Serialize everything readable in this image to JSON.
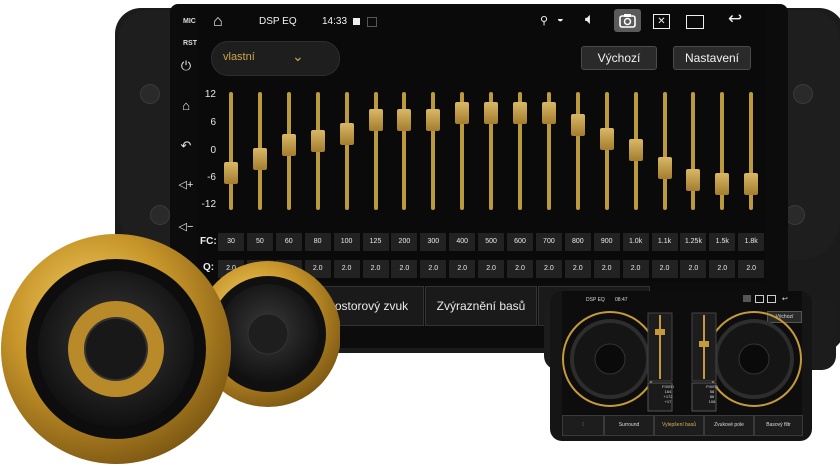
{
  "status_bar": {
    "title": "DSP EQ",
    "time": "14:33",
    "icons": [
      "home-icon",
      "gallery-icon",
      "location-icon",
      "wifi-icon",
      "volume-icon",
      "camera-icon",
      "close-window-icon",
      "window-icon",
      "back-icon"
    ]
  },
  "side_panel": {
    "mic_label": "MIC",
    "rst_label": "RST",
    "icons": [
      "power-icon",
      "home-icon",
      "back-icon",
      "volume-up-icon",
      "volume-down-icon"
    ]
  },
  "eq": {
    "preset_value": "vlastní",
    "default_button": "Výchozí",
    "settings_button": "Nastavení",
    "y_axis": [
      "12",
      "6",
      "0",
      "-6",
      "-12"
    ],
    "fc_label": "FC:",
    "q_label": "Q:",
    "bands": [
      {
        "fc": "30",
        "q": "2.0",
        "gain": -5.0
      },
      {
        "fc": "50",
        "q": "2.0",
        "gain": -2.0
      },
      {
        "fc": "60",
        "q": "2.0",
        "gain": 1.0
      },
      {
        "fc": "80",
        "q": "2.0",
        "gain": 2.0
      },
      {
        "fc": "100",
        "q": "2.0",
        "gain": 3.5
      },
      {
        "fc": "125",
        "q": "2.0",
        "gain": 6.5
      },
      {
        "fc": "200",
        "q": "2.0",
        "gain": 6.5
      },
      {
        "fc": "300",
        "q": "2.0",
        "gain": 6.5
      },
      {
        "fc": "400",
        "q": "2.0",
        "gain": 8.0
      },
      {
        "fc": "500",
        "q": "2.0",
        "gain": 8.0
      },
      {
        "fc": "600",
        "q": "2.0",
        "gain": 8.0
      },
      {
        "fc": "700",
        "q": "2.0",
        "gain": 8.0
      },
      {
        "fc": "800",
        "q": "2.0",
        "gain": 5.5
      },
      {
        "fc": "900",
        "q": "2.0",
        "gain": 2.5
      },
      {
        "fc": "1.0k",
        "q": "2.0",
        "gain": 0.0
      },
      {
        "fc": "1.1k",
        "q": "2.0",
        "gain": -4.0
      },
      {
        "fc": "1.25k",
        "q": "2.0",
        "gain": -6.5
      },
      {
        "fc": "1.5k",
        "q": "2.0",
        "gain": -7.5
      },
      {
        "fc": "1.8k",
        "q": "2.0",
        "gain": -7.5
      }
    ]
  },
  "tabs": [
    "Prostorový zvuk",
    "Zvýraznění basů"
  ],
  "mini_device": {
    "title": "DSP EQ",
    "time": "08:47",
    "top_button": "Výchozí",
    "tabs": [
      "Surround",
      "Vylepšení basů",
      "Zvukové pole",
      "Basový filtr"
    ],
    "active_tab": "Vylepšení basů",
    "left_panel": [
      "FIXED",
      "164",
      "+172",
      "+17"
    ],
    "right_panel": [
      "FIXED",
      "58",
      "86",
      "108"
    ]
  },
  "colors": {
    "gold": "#bb9a3d",
    "screen_bg": "#0a0a0a",
    "frame": "#1b1b1b"
  }
}
